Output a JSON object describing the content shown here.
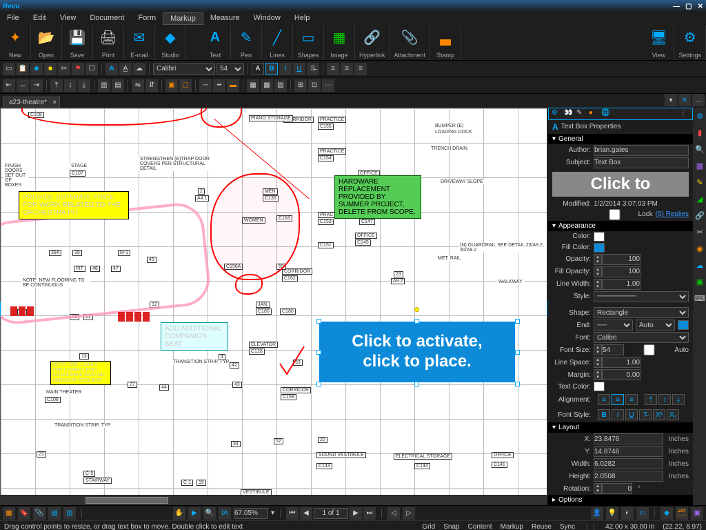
{
  "app": "Revu",
  "menus": [
    "File",
    "Edit",
    "View",
    "Document",
    "Form",
    "Markup",
    "Measure",
    "Window",
    "Help"
  ],
  "active_menu": "Markup",
  "toolbar1": {
    "groups": [
      {
        "label": "New"
      },
      {
        "label": "Open"
      },
      {
        "label": "Save"
      },
      {
        "label": "Print"
      },
      {
        "label": "E-mail"
      },
      {
        "label": "Studio"
      }
    ],
    "groups2": [
      {
        "label": "Text"
      },
      {
        "label": "Pen"
      },
      {
        "label": "Lines"
      },
      {
        "label": "Shapes"
      },
      {
        "label": "Image"
      },
      {
        "label": "Hyperlink"
      },
      {
        "label": "Attachment"
      },
      {
        "label": "Stamp"
      }
    ],
    "right": [
      {
        "label": "View"
      },
      {
        "label": "Settings"
      }
    ]
  },
  "fontbar": {
    "font": "Calibri",
    "size": "54"
  },
  "tab": "a23-theatre*",
  "callouts": {
    "yellow": "PROVIDE SEPARATE PRICE FOR WORK RELATED TO THE ORCHESTRA PIT",
    "green": "HARDWARE REPLACEMENT PROVIDED BY SUMMER PROJECT, DELETE FROM SCOPE.",
    "cyan": "ADD ADDITIONAL COMPANION SEAT",
    "note_yellow": "NOTE: SEE 1,2/A4.2 FOR LOWER LEVEL ACCESSIBLE SEATING HARDSHIP REQUEST",
    "bigblue_l1": "Click to activate,",
    "bigblue_l2": "click to place."
  },
  "floorplan_labels": {
    "strengthen": "STRENGTHEN (E)TRAP DOOR COVERS PER STRUCTURAL DETAIL",
    "flooring": "NOTE: NEW FLOORING TO BE CONTINUOUS",
    "bumper": "BUMPER (E)",
    "loading": "LOADING DOCK",
    "trench": "TRENCH DRAIN",
    "driveway": "DRIVEWAY SLOPE",
    "walkway": "WALKWAY",
    "guardrail": "(N) GUARDRAIL SEE DETAIL 23/A9.2, 30/A9.2",
    "main_theater": "MAIN THEATER",
    "transition": "TRANSITION STRIP, TYP.",
    "stairway": "STAIRWAY",
    "vestibule": "VESTIBULE",
    "elevator": "ELEVATOR",
    "corridor": "CORRIDOR",
    "practice": "PRACTICE",
    "office": "OFFICE",
    "electrical": "ELECTRICAL STORAGE",
    "sound": "SOUND VESTIBULE",
    "met": "MET. RAIL",
    "piano": "PIANO STORAGE",
    "finish": "FINISH DOORS SET OUT OF BOXES",
    "stage": "STAGE",
    "women": "WOMEN"
  },
  "props": {
    "title": "Text Box Properties",
    "general": "General",
    "author_lbl": "Author:",
    "author": "brian.gates",
    "subject_lbl": "Subject:",
    "subject": "Text Box",
    "preview": "Click to",
    "modified_lbl": "Modified:",
    "modified": "1/2/2014 3:07:03 PM",
    "lock": "Lock",
    "replies": "(0) Replies",
    "appearance": "Appearance",
    "color_lbl": "Color:",
    "fillcolor_lbl": "Fill Color:",
    "opacity_lbl": "Opacity:",
    "opacity": "100",
    "fillopacity_lbl": "Fill Opacity:",
    "fillopacity": "100",
    "linewidth_lbl": "Line Width:",
    "linewidth": "1.00",
    "style_lbl": "Style:",
    "shape_lbl": "Shape:",
    "shape": "Rectangle",
    "end_lbl": "End:",
    "end_auto": "Auto",
    "font_lbl": "Font:",
    "font": "Calibri",
    "fontsize_lbl": "Font Size:",
    "fontsize": "54",
    "auto": "Auto",
    "linespace_lbl": "Line Space:",
    "linespace": "1.00",
    "margin_lbl": "Margin:",
    "margin": "0.00",
    "textcolor_lbl": "Text Color:",
    "alignment_lbl": "Alignment:",
    "fontstyle_lbl": "Font Style:",
    "layout": "Layout",
    "x_lbl": "X:",
    "x": "23.8476",
    "y_lbl": "Y:",
    "y": "14.8746",
    "width_lbl": "Width:",
    "width": "6.0282",
    "height_lbl": "Height:",
    "height": "2.0508",
    "rotation_lbl": "Rotation:",
    "rotation": "0",
    "inches": "Inches",
    "deg": "°",
    "options": "Options"
  },
  "bottombar": {
    "zoom": "67.05%",
    "page": "1 of 1"
  },
  "statusbar": {
    "hint": "Drag control points to resize, or drag text box to move. Double click to edit text",
    "links": [
      "Grid",
      "Snap",
      "Content",
      "Markup",
      "Reuse",
      "Sync"
    ],
    "dims": "42.00 x 30.00 in",
    "cursor": "(22.22, 8.97)"
  }
}
